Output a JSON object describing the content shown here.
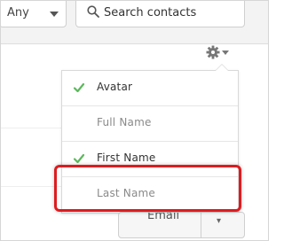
{
  "toolbar": {
    "filter_select": {
      "value": "Any"
    },
    "search": {
      "placeholder": "Search contacts"
    }
  },
  "column_menu": {
    "trigger_icon": "gear-icon",
    "items": [
      {
        "label": "Avatar",
        "checked": true
      },
      {
        "label": "Full Name",
        "checked": false
      },
      {
        "label": "First Name",
        "checked": true
      },
      {
        "label": "Last Name",
        "checked": false
      }
    ]
  },
  "email_button": {
    "label": "Email"
  },
  "colors": {
    "check": "#5cb85c",
    "highlight": "#de1b1f"
  }
}
